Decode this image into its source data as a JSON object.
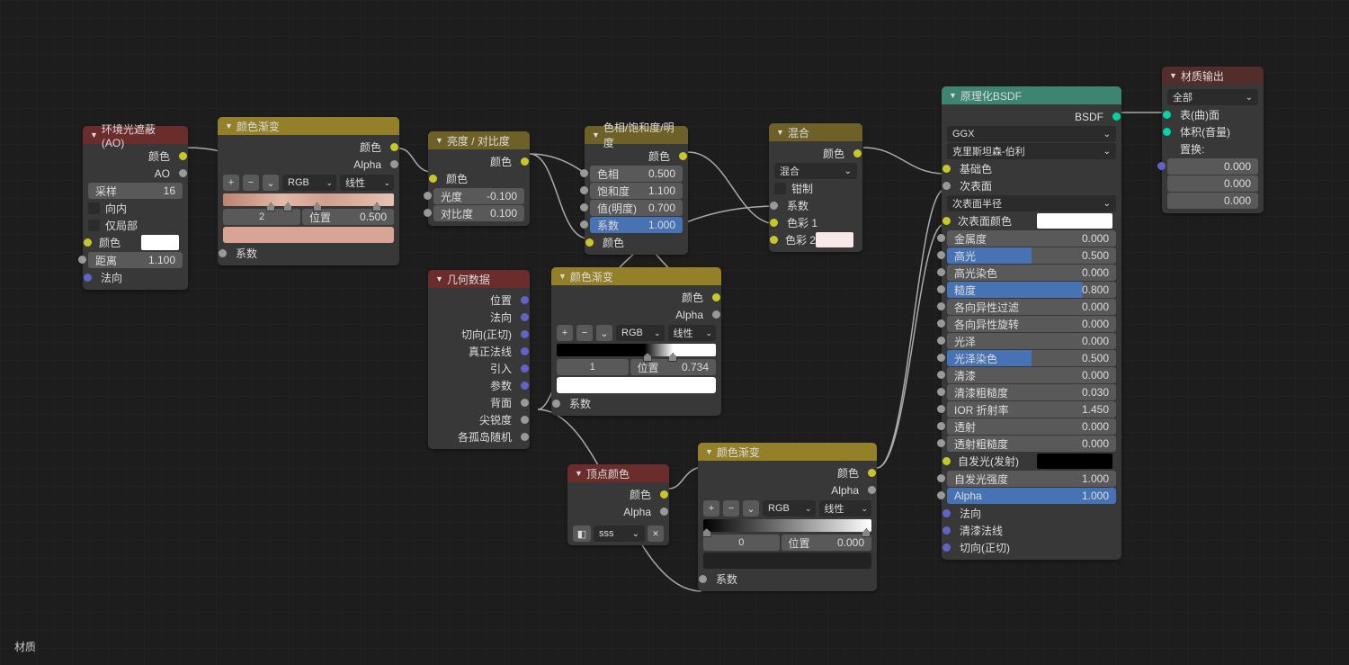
{
  "footer": "材质",
  "ao": {
    "title": "环境光遮蔽 (AO)",
    "out_color": "颜色",
    "out_ao": "AO",
    "samples_l": "采样",
    "samples_v": "16",
    "inside": "向内",
    "local": "仅局部",
    "color_l": "颜色",
    "dist_l": "距离",
    "dist_v": "1.100",
    "normal": "法向"
  },
  "cr1": {
    "title": "颜色渐变",
    "out_color": "颜色",
    "out_alpha": "Alpha",
    "mode": "RGB",
    "interp": "线性",
    "idx": "2",
    "pos_l": "位置",
    "pos_v": "0.500",
    "fac": "系数"
  },
  "bc": {
    "title": "亮度 / 对比度",
    "out": "颜色",
    "color": "颜色",
    "bright_l": "光度",
    "bright_v": "-0.100",
    "contrast_l": "对比度",
    "contrast_v": "0.100"
  },
  "hsv": {
    "title": "色相/饱和度/明度",
    "out": "颜色",
    "hue_l": "色相",
    "hue_v": "0.500",
    "sat_l": "饱和度",
    "sat_v": "1.100",
    "val_l": "值(明度)",
    "val_v": "0.700",
    "fac_l": "系数",
    "fac_v": "1.000",
    "color": "颜色"
  },
  "mix": {
    "title": "混合",
    "out": "颜色",
    "mode": "混合",
    "clamp": "钳制",
    "fac": "系数",
    "c1": "色彩 1",
    "c2": "色彩 2"
  },
  "geo": {
    "title": "几何数据",
    "pos": "位置",
    "nor": "法向",
    "tan": "切向(正切)",
    "tnor": "真正法线",
    "inc": "引入",
    "par": "参数",
    "bf": "背面",
    "pt": "尖锐度",
    "ri": "各孤岛随机"
  },
  "cr2": {
    "title": "颜色渐变",
    "out_color": "颜色",
    "out_alpha": "Alpha",
    "mode": "RGB",
    "interp": "线性",
    "idx": "1",
    "pos_l": "位置",
    "pos_v": "0.734",
    "fac": "系数"
  },
  "vc": {
    "title": "顶点颜色",
    "out_color": "颜色",
    "out_alpha": "Alpha",
    "name": "sss"
  },
  "cr3": {
    "title": "颜色渐变",
    "out_color": "颜色",
    "out_alpha": "Alpha",
    "mode": "RGB",
    "interp": "线性",
    "idx": "0",
    "pos_l": "位置",
    "pos_v": "0.000",
    "fac": "系数"
  },
  "bsdf": {
    "title": "原理化BSDF",
    "out": "BSDF",
    "dist": "GGX",
    "sss": "克里斯坦森-伯利",
    "base": "基础色",
    "sub": "次表面",
    "subr": "次表面半径",
    "subc": "次表面颜色",
    "met_l": "金属度",
    "met_v": "0.000",
    "spec_l": "高光",
    "spec_v": "0.500",
    "spect_l": "高光染色",
    "spect_v": "0.000",
    "rough_l": "糙度",
    "rough_v": "0.800",
    "aniso_l": "各向异性过滤",
    "aniso_v": "0.000",
    "anisor_l": "各向异性旋转",
    "anisor_v": "0.000",
    "sheen_l": "光泽",
    "sheen_v": "0.000",
    "sheent_l": "光泽染色",
    "sheent_v": "0.500",
    "cc_l": "清漆",
    "cc_v": "0.000",
    "ccr_l": "清漆粗糙度",
    "ccr_v": "0.030",
    "ior_l": "IOR 折射率",
    "ior_v": "1.450",
    "trans_l": "透射",
    "trans_v": "0.000",
    "transr_l": "透射粗糙度",
    "transr_v": "0.000",
    "emit": "自发光(发射)",
    "emits_l": "自发光强度",
    "emits_v": "1.000",
    "alpha_l": "Alpha",
    "alpha_v": "1.000",
    "norm": "法向",
    "ccn": "清漆法线",
    "tang": "切向(正切)"
  },
  "out": {
    "title": "材质输出",
    "tgt": "全部",
    "surf": "表(曲)面",
    "vol": "体积(音量)",
    "disp": "置换:",
    "v0": "0.000",
    "v1": "0.000",
    "v2": "0.000"
  }
}
